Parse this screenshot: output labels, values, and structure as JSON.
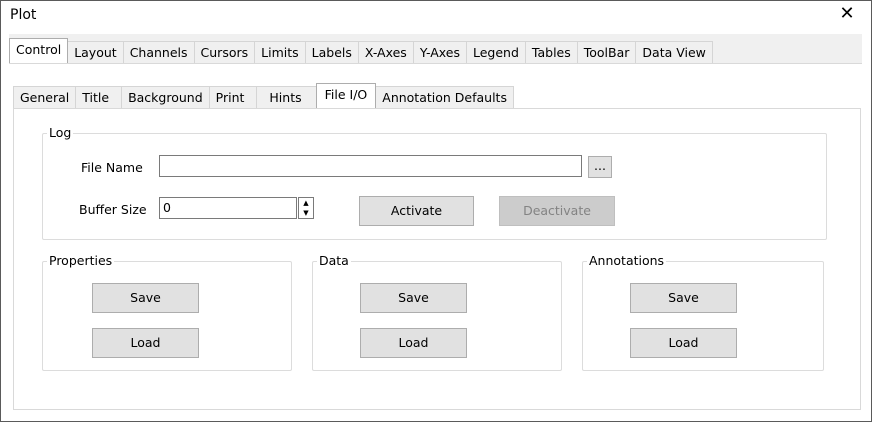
{
  "window": {
    "title": "Plot",
    "close_glyph": "✕"
  },
  "outer_tabs": [
    "Control",
    "Layout",
    "Channels",
    "Cursors",
    "Limits",
    "Labels",
    "X-Axes",
    "Y-Axes",
    "Legend",
    "Tables",
    "ToolBar",
    "Data View"
  ],
  "inner_tabs": [
    "General",
    "Title",
    "Background",
    "Print",
    "Hints",
    "File I/O",
    "Annotation Defaults"
  ],
  "active_outer_tab": "Control",
  "active_inner_tab": "File I/O",
  "log": {
    "group_label": "Log",
    "file_name_label": "File Name",
    "file_name_value": "",
    "browse_label": "...",
    "buffer_size_label": "Buffer Size",
    "buffer_size_value": "0",
    "activate_label": "Activate",
    "deactivate_label": "Deactivate"
  },
  "properties": {
    "group_label": "Properties",
    "save_label": "Save",
    "load_label": "Load"
  },
  "data": {
    "group_label": "Data",
    "save_label": "Save",
    "load_label": "Load"
  },
  "annotations": {
    "group_label": "Annotations",
    "save_label": "Save",
    "load_label": "Load"
  }
}
